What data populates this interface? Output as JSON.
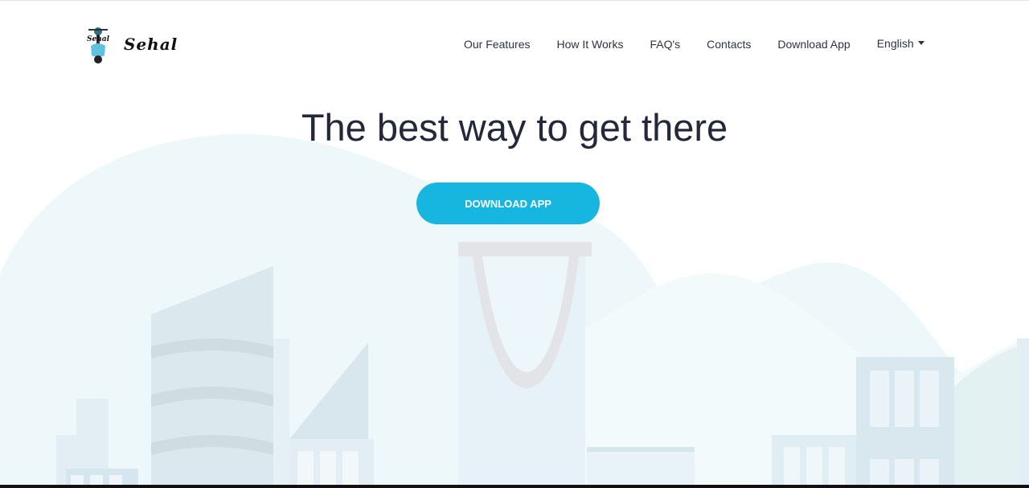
{
  "brand": {
    "name": "Sehal",
    "logo_mark_text": "Sehal"
  },
  "nav": {
    "items": [
      {
        "label": "Our Features"
      },
      {
        "label": "How It Works"
      },
      {
        "label": "FAQ's"
      },
      {
        "label": "Contacts"
      },
      {
        "label": "Download App"
      }
    ],
    "language": "English"
  },
  "hero": {
    "title": "The best way to get there",
    "cta_label": "DOWNLOAD APP"
  },
  "colors": {
    "accent": "#16b6e0",
    "heading": "#23283a",
    "nav_text": "#2d3340"
  }
}
